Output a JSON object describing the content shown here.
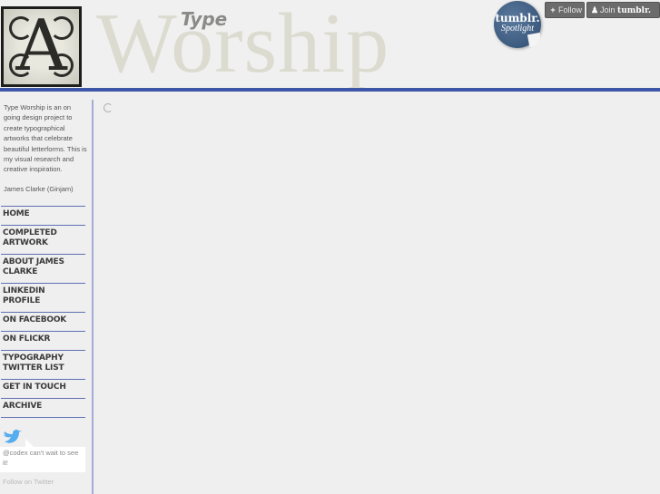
{
  "header": {
    "logo_letter": "A",
    "title_small": "Type",
    "title_large": "Worship"
  },
  "tumblr": {
    "badge_line1": "tumblr.",
    "badge_line2": "Spotlight",
    "follow_label": "Follow",
    "follow_icon": "plus-icon",
    "join_label": "Join",
    "join_brand": "tumblr.",
    "join_icon": "user-icon"
  },
  "sidebar": {
    "about": "Type Worship is an on going design project to create typographical artworks that celebrate beautiful letterforms. This is my visual research and creative inspiration.",
    "author": "James Clarke (Ginjam)",
    "nav": [
      {
        "label": "Home"
      },
      {
        "label": "Completed Artwork"
      },
      {
        "label": "About James Clarke"
      },
      {
        "label": "LinkedIn Profile"
      },
      {
        "label": "On Facebook"
      },
      {
        "label": "On Flickr"
      },
      {
        "label": "Typography Twitter List"
      },
      {
        "label": "Get In Touch"
      },
      {
        "label": "Archive"
      }
    ],
    "tweet": "@codex can't wait to see it!",
    "follow_twitter": "Follow on Twitter"
  },
  "main": {
    "loading_icon": "spinner-icon"
  },
  "colors": {
    "accent_blue": "#3e56a8",
    "nav_divider": "#5e6fb4",
    "twitter_blue": "#55acee"
  }
}
